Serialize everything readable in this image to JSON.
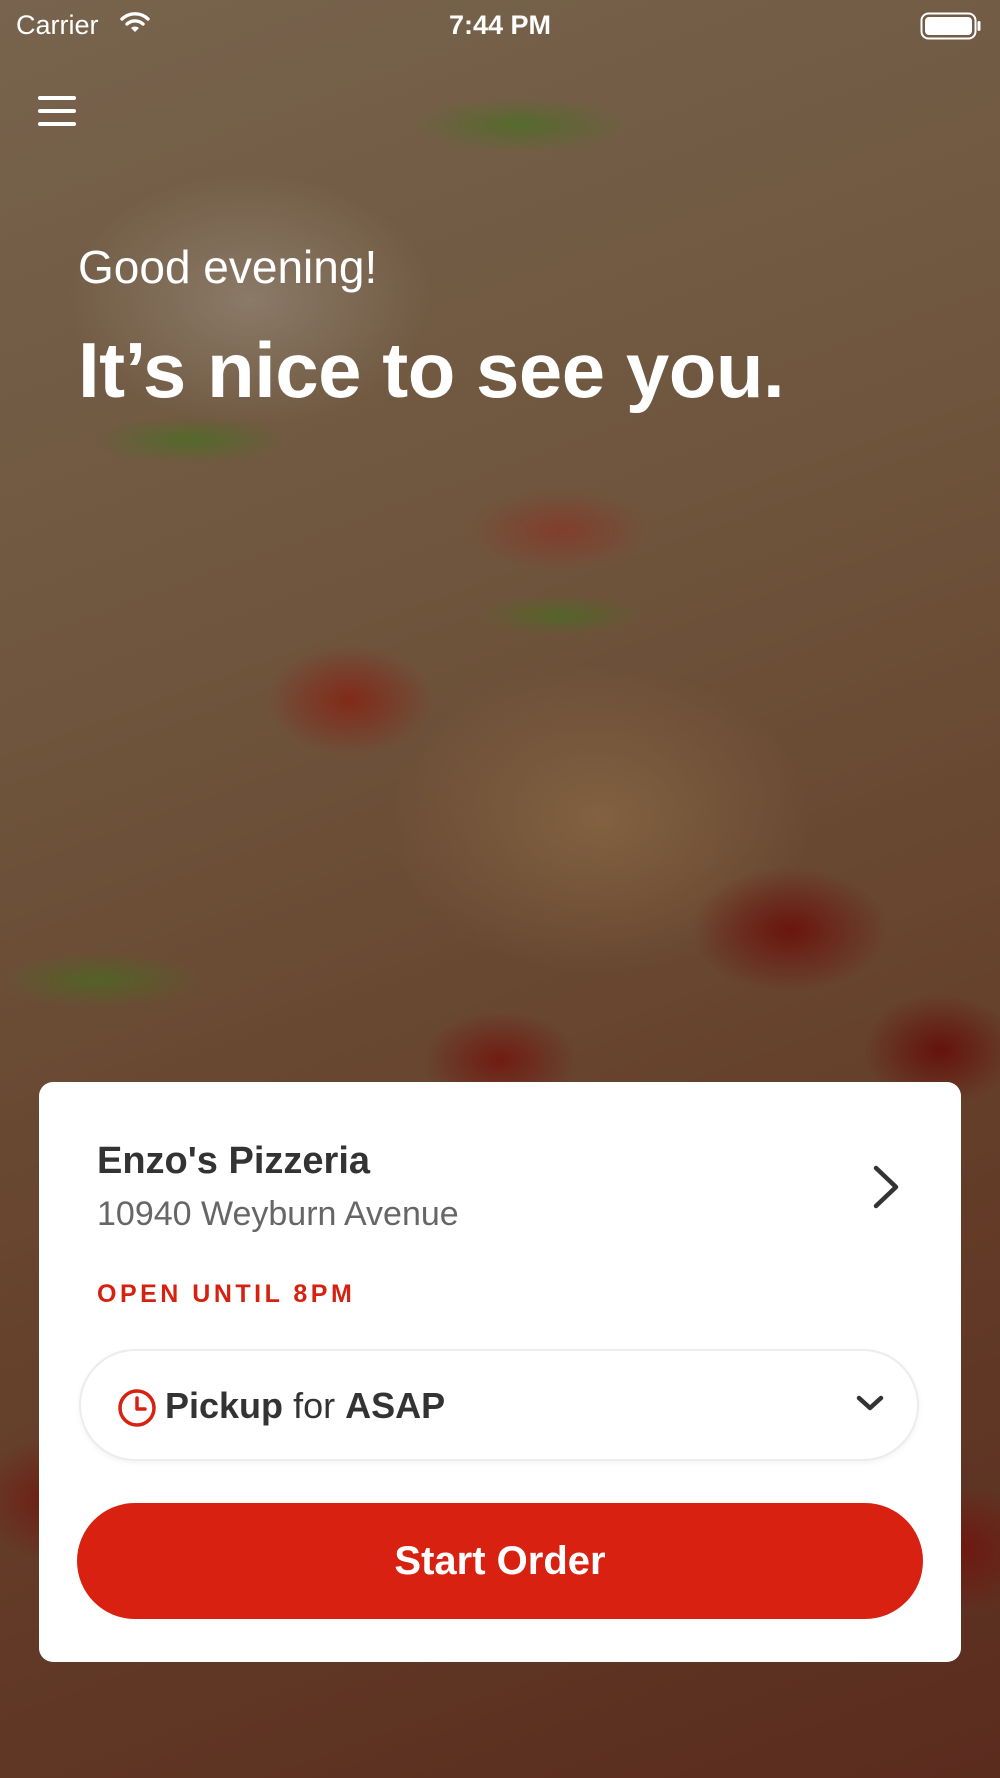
{
  "status_bar": {
    "carrier": "Carrier",
    "time": "7:44 PM"
  },
  "header": {
    "menu_icon": "hamburger-menu-icon"
  },
  "hero": {
    "greeting": "Good evening!",
    "headline": "It’s nice to see you."
  },
  "store_card": {
    "name": "Enzo's Pizzeria",
    "address": "10940 Weyburn Avenue",
    "hours": "OPEN UNTIL 8PM",
    "order_mode": "Pickup",
    "order_connector": "for",
    "order_time": "ASAP",
    "start_button_label": "Start Order"
  },
  "colors": {
    "accent": "#d82110",
    "card_background": "#ffffff",
    "text_primary": "#333333",
    "text_secondary": "#666666"
  }
}
